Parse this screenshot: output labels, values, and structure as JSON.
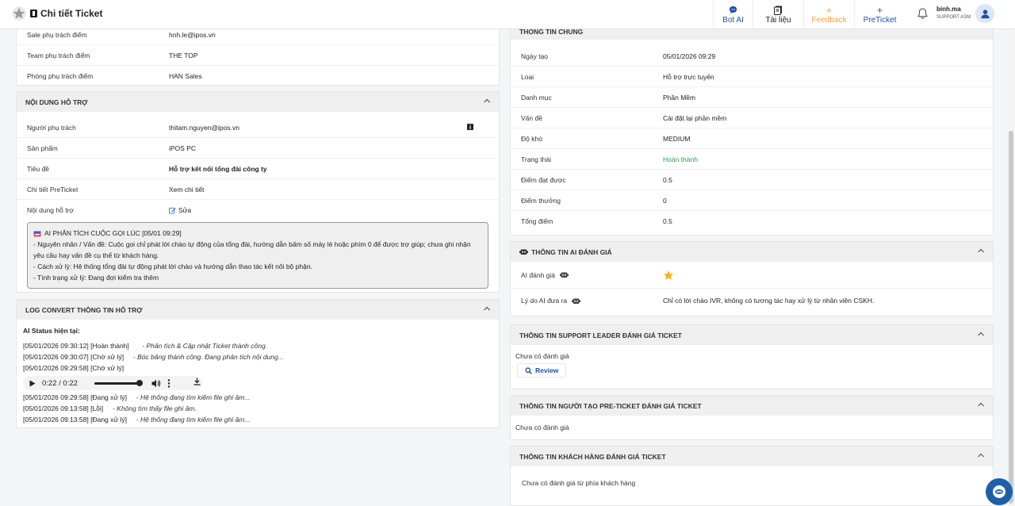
{
  "header": {
    "title": "Chi tiết Ticket",
    "nav": [
      {
        "label": "Bot AI",
        "icon": "chat-bubble-icon"
      },
      {
        "label": "Tài liệu",
        "icon": "document-icon"
      },
      {
        "label": "Feedback",
        "icon": "plus-icon"
      },
      {
        "label": "PreTicket",
        "icon": "plus-icon"
      }
    ],
    "user": {
      "name": "binh.ma",
      "role": "SUPPORT ASM"
    }
  },
  "left": {
    "customer_rows": [
      {
        "k": "Sale phụ trách điểm",
        "v": "hnh.le@ipos.vn"
      },
      {
        "k": "Team phụ trách điểm",
        "v": "THE TOP"
      },
      {
        "k": "Phòng phụ trách điểm",
        "v": "HAN Sales"
      }
    ],
    "support": {
      "title": "NỘI DUNG HỖ TRỢ",
      "rows": [
        {
          "k": "Người phụ trách",
          "v": "thitam.nguyen@ipos.vn"
        },
        {
          "k": "Sản phẩm",
          "v": "iPOS PC"
        },
        {
          "k": "Tiêu đề",
          "v": "Hỗ trợ kết nối tổng đài công ty"
        },
        {
          "k": "Chi tiết PreTicket",
          "v": "Xem chi tiết"
        },
        {
          "k": "Nội dung hỗ trợ",
          "v": "Sửa"
        }
      ],
      "ai_box": [
        "AI PHÂN TÍCH CUỘC GỌI LÚC [05/01 09:29]",
        "- Nguyên nhân / Vấn đề: Cuộc gọi chỉ phát lời chào tự động của tổng đài, hướng dẫn bấm số máy lẻ hoặc phím 0 để được trợ giúp; chưa ghi nhận yêu cầu hay vấn đề cụ thể từ khách hàng.",
        "- Cách xử lý: Hệ thống tổng đài tự động phát lời chào và hướng dẫn thao tác kết nối bộ phận.",
        "- Tình trạng xử lý: Đang đợi kiểm tra thêm"
      ]
    },
    "log": {
      "title": "LOG CONVERT THÔNG TIN HỖ TRỢ",
      "status_label": "AI Status hiện tại:",
      "lines_before": [
        {
          "t": "[05/01/2026 09:30:12]",
          "s": "[Hoàn thành]",
          "m": "- Phân tích & Cập nhật Ticket thành công."
        },
        {
          "t": "[05/01/2026 09:30:07]",
          "s": "[Chờ xử lý]",
          "m": "- Bóc băng thành công. Đang phân tích nội dung..."
        },
        {
          "t": "[05/01/2026 09:29:58]",
          "s": "[Chờ xử lý]",
          "m": ""
        }
      ],
      "audio_time": "0:22 / 0:22",
      "lines_after": [
        {
          "t": "[05/01/2026 09:29:58]",
          "s": "[Đang xử lý]",
          "m": "- Hệ thống đang tìm kiếm file ghi âm..."
        },
        {
          "t": "[05/01/2026 09:13:58]",
          "s": "[Lỗi]",
          "m": "- Không tìm thấy file ghi âm."
        },
        {
          "t": "[05/01/2026 09:13:58]",
          "s": "[Đang xử lý]",
          "m": "- Hệ thống đang tìm kiếm file ghi âm..."
        }
      ]
    }
  },
  "right": {
    "general": {
      "title": "THÔNG TIN CHUNG",
      "rows": [
        {
          "k": "Ngày tạo",
          "v": "05/01/2026 09:29"
        },
        {
          "k": "Loại",
          "v": "Hỗ trợ trực tuyến"
        },
        {
          "k": "Danh mục",
          "v": "Phần Mềm"
        },
        {
          "k": "Vấn đề",
          "v": "Cài đặt lại phần mềm"
        },
        {
          "k": "Độ khó",
          "v": "MEDIUM"
        },
        {
          "k": "Trạng thái",
          "v": "Hoàn thành"
        },
        {
          "k": "Điểm đạt được",
          "v": "0.5"
        },
        {
          "k": "Điểm thưởng",
          "v": "0"
        },
        {
          "k": "Tổng điểm",
          "v": "0.5"
        }
      ],
      "status_color": "#2e9d4a"
    },
    "ai_eval": {
      "title": "THÔNG TIN AI ĐÁNH GIÁ",
      "rating_label": "AI đánh giá",
      "rating_stars": 1,
      "reason_label": "Lý do AI đưa ra",
      "reason": "Chỉ có lời chào IVR, không có tương tác hay xử lý từ nhân viên CSKH."
    },
    "leader": {
      "title": "THÔNG TIN SUPPORT LEADER ĐÁNH GIÁ TICKET",
      "empty": "Chưa có đánh giá",
      "review": "Review"
    },
    "creator": {
      "title": "THÔNG TIN NGƯỜI TẠO PRE-TICKET ĐÁNH GIÁ TICKET",
      "empty": "Chưa có đánh giá"
    },
    "customer": {
      "title": "THÔNG TIN KHÁCH HÀNG ĐÁNH GIÁ TICKET",
      "empty": "Chưa có đánh giá từ phía khách hàng"
    }
  }
}
